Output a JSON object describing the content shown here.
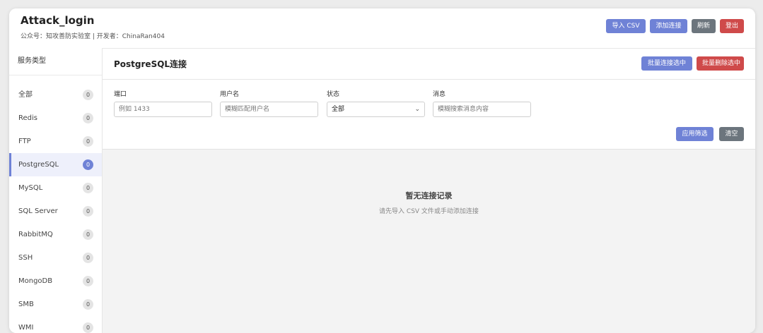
{
  "header": {
    "title": "Attack_login",
    "subtitle": "公众号：知攻善防实验室 | 开发者：ChinaRan404",
    "buttons": {
      "import_csv": "导入 CSV",
      "add_conn": "添加连接",
      "refresh": "刷新",
      "logout": "登出"
    }
  },
  "sidebar": {
    "title": "服务类型",
    "items": [
      {
        "label": "全部",
        "count": "0"
      },
      {
        "label": "Redis",
        "count": "0"
      },
      {
        "label": "FTP",
        "count": "0"
      },
      {
        "label": "PostgreSQL",
        "count": "0"
      },
      {
        "label": "MySQL",
        "count": "0"
      },
      {
        "label": "SQL Server",
        "count": "0"
      },
      {
        "label": "RabbitMQ",
        "count": "0"
      },
      {
        "label": "SSH",
        "count": "0"
      },
      {
        "label": "MongoDB",
        "count": "0"
      },
      {
        "label": "SMB",
        "count": "0"
      },
      {
        "label": "WMI",
        "count": "0"
      }
    ],
    "active_index": 3
  },
  "main": {
    "title": "PostgreSQL连接",
    "buttons": {
      "batch_connect": "批量连接选中",
      "batch_delete": "批量删除选中"
    },
    "filters": {
      "port": {
        "label": "端口",
        "placeholder": "例如 1433"
      },
      "username": {
        "label": "用户名",
        "placeholder": "模糊匹配用户名"
      },
      "status": {
        "label": "状态",
        "value": "全部"
      },
      "message": {
        "label": "消息",
        "placeholder": "模糊搜索消息内容"
      },
      "apply": "应用筛选",
      "clear": "清空"
    },
    "empty": {
      "title": "暂无连接记录",
      "subtitle": "请先导入 CSV 文件或手动添加连接"
    }
  },
  "colors": {
    "primary": "#6f82d6",
    "danger": "#cf4a4a",
    "secondary": "#6c757d"
  }
}
